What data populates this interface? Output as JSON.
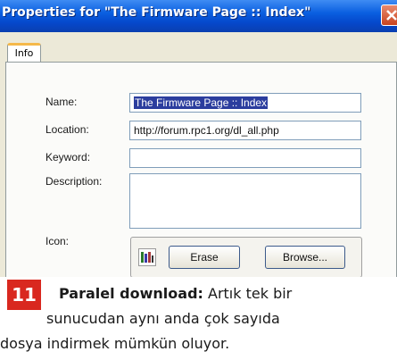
{
  "dialog": {
    "title": "Properties for \"The Firmware Page :: Index\"",
    "tab_label": "Info"
  },
  "fields": {
    "name_label": "Name:",
    "name_value": "The Firmware Page :: Index",
    "location_label": "Location:",
    "location_value": "http://forum.rpc1.org/dl_all.php",
    "keyword_label": "Keyword:",
    "keyword_value": "",
    "description_label": "Description:",
    "description_value": "",
    "icon_label": "Icon:"
  },
  "buttons": {
    "erase_label": "Erase",
    "browse_label": "Browse..."
  },
  "icons": {
    "close": "close-icon",
    "favicon": "page-favicon-icon"
  },
  "caption": {
    "number": "11",
    "bold": "Paralel download:",
    "line1_rest": " Artık tek bir",
    "line2": "sunucudan aynı anda çok sayıda",
    "line3": "dosya indirmek mümkün oluyor."
  },
  "colors": {
    "titlebar": "#0a5fe0",
    "selection": "#2b3d9e",
    "badge": "#d9281f"
  }
}
